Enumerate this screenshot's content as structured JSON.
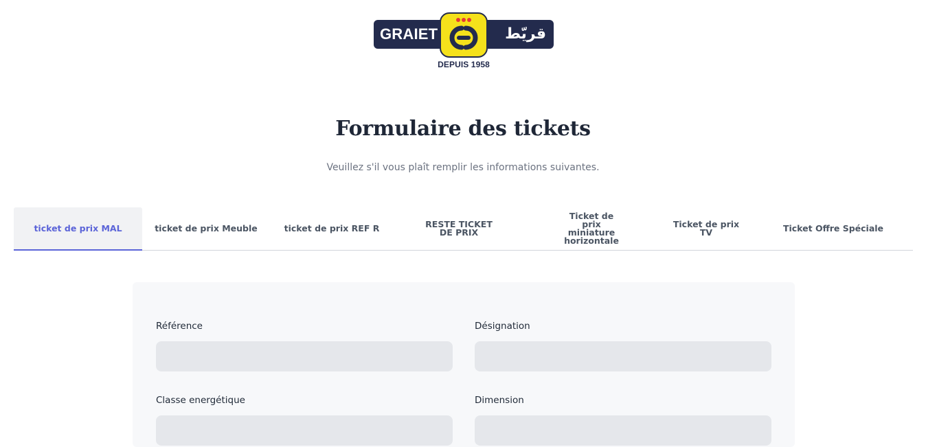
{
  "logo": {
    "latin_text": "GRAIET",
    "arabic_text": "قريّط",
    "since_text": "DEPUIS 1958",
    "colors": {
      "navy": "#232b4d",
      "yellow": "#f5e11b",
      "red": "#e53935"
    }
  },
  "header": {
    "title": "Formulaire des tickets",
    "subtitle": "Veuillez s'il vous plaît remplir les informations suivantes."
  },
  "tabs": [
    {
      "label": "ticket de prix MAL",
      "active": true
    },
    {
      "label": "ticket de prix Meuble",
      "active": false
    },
    {
      "label": "ticket de prix REF R",
      "active": false
    },
    {
      "label": "RESTE TICKET DE PRIX",
      "active": false
    },
    {
      "label": "Ticket de prix miniature horizontale",
      "active": false
    },
    {
      "label": "Ticket de prix TV",
      "active": false
    },
    {
      "label": "Ticket Offre Spéciale",
      "active": false
    }
  ],
  "form": {
    "fields": [
      {
        "label": "Référence",
        "value": "",
        "placeholder": ""
      },
      {
        "label": "Désignation",
        "value": "",
        "placeholder": ""
      },
      {
        "label": "Classe energétique",
        "value": "",
        "placeholder": ""
      },
      {
        "label": "Dimension",
        "value": "",
        "placeholder": ""
      }
    ]
  },
  "colors": {
    "accent": "#5b64d8",
    "title": "#1f2737",
    "panel": "#f7f8fa",
    "input": "#e5e7eb"
  }
}
